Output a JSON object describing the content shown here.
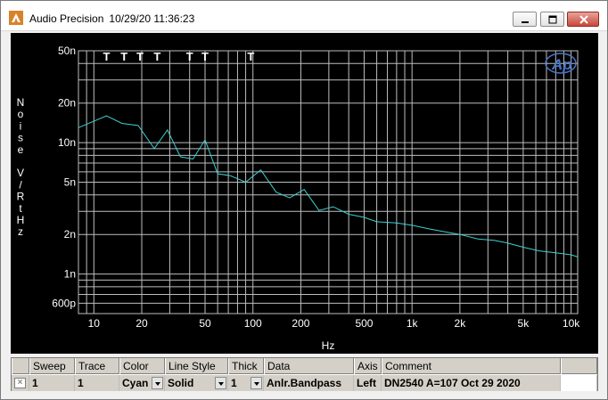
{
  "window": {
    "title": "Audio Precision",
    "timestamp": "10/29/20 11:36:23",
    "buttons": {
      "minimize": "minimize-icon",
      "maximize": "maximize-icon",
      "close": "close-icon"
    }
  },
  "logo_text": "Ap",
  "chart_data": {
    "type": "line",
    "title": "",
    "xlabel": "Hz",
    "ylabel": "Noise V/RtHz",
    "x_scale": "log",
    "y_scale": "log",
    "xlim": [
      8,
      11000
    ],
    "ylim": [
      5e-10,
      5e-08
    ],
    "x_ticks": [
      {
        "value": 10,
        "label": "10"
      },
      {
        "value": 20,
        "label": "20"
      },
      {
        "value": 50,
        "label": "50"
      },
      {
        "value": 100,
        "label": "100"
      },
      {
        "value": 200,
        "label": "200"
      },
      {
        "value": 500,
        "label": "500"
      },
      {
        "value": 1000,
        "label": "1k"
      },
      {
        "value": 2000,
        "label": "2k"
      },
      {
        "value": 5000,
        "label": "5k"
      },
      {
        "value": 10000,
        "label": "10k"
      }
    ],
    "y_ticks": [
      {
        "value": 5e-08,
        "label": "50n"
      },
      {
        "value": 2e-08,
        "label": "20n"
      },
      {
        "value": 1e-08,
        "label": "10n"
      },
      {
        "value": 5e-09,
        "label": "5n"
      },
      {
        "value": 2e-09,
        "label": "2n"
      },
      {
        "value": 1e-09,
        "label": "1n"
      },
      {
        "value": 6e-10,
        "label": "600p"
      }
    ],
    "grid": true,
    "series": [
      {
        "color": "#3fd0d0",
        "x": [
          8,
          12,
          15,
          19,
          24,
          29,
          35,
          42,
          50,
          60,
          72,
          90,
          112,
          140,
          170,
          210,
          260,
          320,
          400,
          500,
          600,
          800,
          1000,
          1300,
          1600,
          2000,
          2600,
          3300,
          4000,
          5000,
          6300,
          8000,
          10000,
          11000
        ],
        "y": [
          1.3e-08,
          1.6e-08,
          1.4e-08,
          1.35e-08,
          9e-09,
          1.25e-08,
          7.8e-09,
          7.5e-09,
          1.05e-08,
          5.8e-09,
          5.6e-09,
          5e-09,
          6.2e-09,
          4.2e-09,
          3.8e-09,
          4.4e-09,
          3.05e-09,
          3.25e-09,
          2.85e-09,
          2.7e-09,
          2.5e-09,
          2.45e-09,
          2.35e-09,
          2.2e-09,
          2.1e-09,
          2e-09,
          1.85e-09,
          1.8e-09,
          1.72e-09,
          1.6e-09,
          1.5e-09,
          1.45e-09,
          1.4e-09,
          1.35e-09
        ]
      }
    ],
    "markers": [
      {
        "x": 12,
        "label": "T"
      },
      {
        "x": 15.5,
        "label": "T"
      },
      {
        "x": 19.5,
        "label": "T"
      },
      {
        "x": 25,
        "label": "T"
      },
      {
        "x": 40,
        "label": "T"
      },
      {
        "x": 50,
        "label": "T"
      },
      {
        "x": 97,
        "label": "T"
      }
    ]
  },
  "table": {
    "columns": [
      "Sweep",
      "Trace",
      "Color",
      "Line Style",
      "Thick",
      "Data",
      "Axis",
      "Comment"
    ],
    "row": {
      "checkbox": "×",
      "sweep": "1",
      "trace": "1",
      "color": "Cyan",
      "line_style": "Solid",
      "thick": "1",
      "data": "Anlr.Bandpass",
      "axis": "Left",
      "comment": "DN2540 A=107 Oct 29 2020"
    }
  }
}
